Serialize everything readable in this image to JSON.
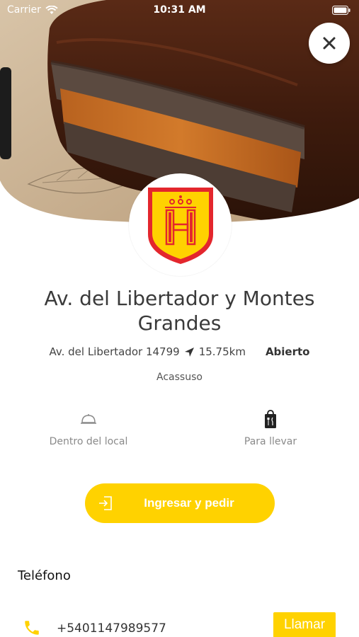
{
  "status_bar": {
    "carrier": "Carrier",
    "time": "10:31 AM"
  },
  "hero": {
    "image": "alfajor-photo",
    "close_icon": "close-icon"
  },
  "store": {
    "name": "Av. del Libertador y Montes Grandes",
    "address": "Av. del Libertador 14799",
    "distance": "15.75km",
    "status": "Abierto",
    "locality": "Acassuso",
    "logo_letter": "H"
  },
  "service_modes": [
    {
      "label": "Dentro del local",
      "icon": "cloche-icon"
    },
    {
      "label": "Para llevar",
      "icon": "takeaway-bag-icon"
    }
  ],
  "order_button": {
    "label": "Ingresar y pedir",
    "icon": "login-icon"
  },
  "phone": {
    "title": "Teléfono",
    "number": "+5401147989577",
    "call_label": "Llamar",
    "icon": "phone-icon"
  },
  "colors": {
    "accent": "#ffd200",
    "logo_red": "#e3262d",
    "logo_yellow": "#ffd200"
  }
}
